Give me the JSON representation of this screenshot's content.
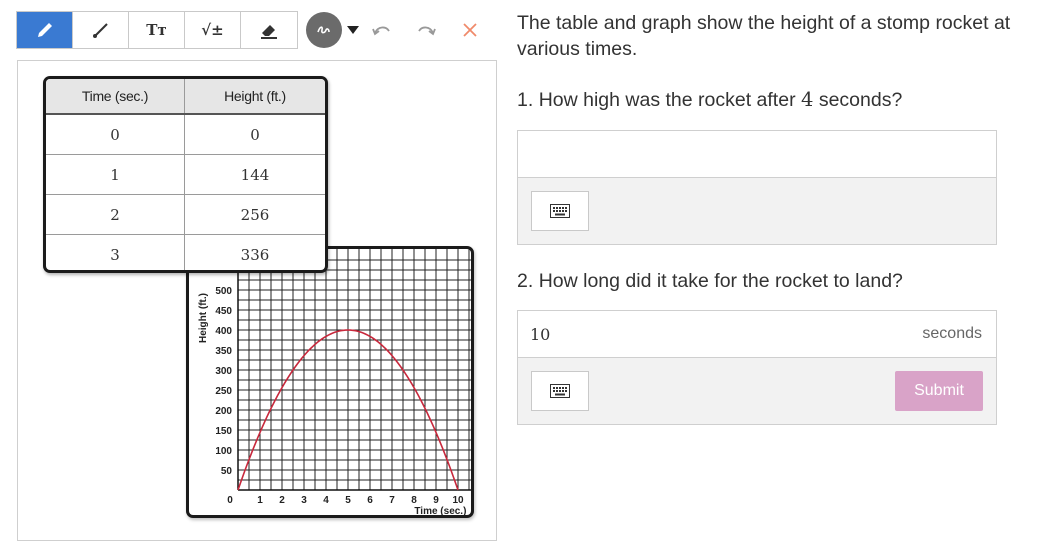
{
  "toolbar": {
    "tools": [
      {
        "name": "pencil-icon",
        "active": true
      },
      {
        "name": "line-icon",
        "active": false
      },
      {
        "name": "text-icon",
        "label": "Tт",
        "active": false
      },
      {
        "name": "math-icon",
        "label": "√±",
        "active": false
      },
      {
        "name": "eraser-icon",
        "active": false
      }
    ],
    "color_picker_icon": "scribble-icon",
    "undo_icon": "undo-icon",
    "redo_icon": "redo-icon",
    "clear_icon": "close-icon"
  },
  "colors": {
    "active_tool": "#3a7ad2",
    "curve": "#c8283c",
    "submit": "#d9a3c8",
    "clear_x": "#f08a6a"
  },
  "table": {
    "headers": [
      "Time (sec.)",
      "Height (ft.)"
    ],
    "rows": [
      [
        "0",
        "0"
      ],
      [
        "1",
        "144"
      ],
      [
        "2",
        "256"
      ],
      [
        "3",
        "336"
      ]
    ]
  },
  "chart_data": {
    "type": "line",
    "xlabel": "Time (sec.)",
    "ylabel": "Height (ft.)",
    "xlim": [
      0,
      10
    ],
    "ylim": [
      0,
      500
    ],
    "x_ticks": [
      "0",
      "1",
      "2",
      "3",
      "4",
      "5",
      "6",
      "7",
      "8",
      "9",
      "10"
    ],
    "y_ticks": [
      "50",
      "100",
      "150",
      "200",
      "250",
      "300",
      "350",
      "400",
      "450",
      "500"
    ],
    "grid": true,
    "series": [
      {
        "x": [
          0,
          1,
          2,
          3,
          4,
          5,
          6,
          7,
          8,
          9,
          10
        ],
        "y": [
          0,
          144,
          256,
          336,
          384,
          400,
          384,
          336,
          256,
          144,
          0
        ]
      }
    ]
  },
  "prompt": {
    "text": "The table and graph show the height of a stomp rocket at various times."
  },
  "questions": [
    {
      "number": "1.",
      "text_before": "How high was the rocket after",
      "value": "4",
      "text_after": "seconds?"
    },
    {
      "number": "2.",
      "text": "How long did it take for the rocket to land?"
    }
  ],
  "answers": [
    {
      "value": "",
      "unit": "",
      "keyboard_icon": "keyboard-icon"
    },
    {
      "value": "10",
      "unit": "seconds",
      "keyboard_icon": "keyboard-icon",
      "submit_label": "Submit"
    }
  ]
}
